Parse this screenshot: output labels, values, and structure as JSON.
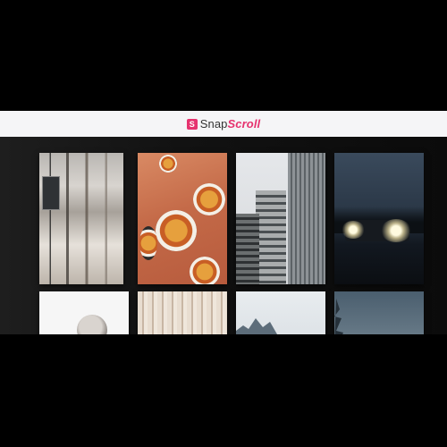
{
  "app": {
    "logo_badge": "S",
    "name_part1": "Snap",
    "name_part2": "Scroll",
    "brand_color": "#e6336f"
  },
  "gallery": {
    "tiles": [
      {
        "subject": "building-with-windows"
      },
      {
        "subject": "food-bowls-on-table"
      },
      {
        "subject": "city-skyscrapers"
      },
      {
        "subject": "car-headlights-at-night"
      },
      {
        "subject": "person-portrait"
      },
      {
        "subject": "abstract-texture"
      },
      {
        "subject": "mountain-peaks"
      },
      {
        "subject": "misty-landscape"
      }
    ]
  }
}
